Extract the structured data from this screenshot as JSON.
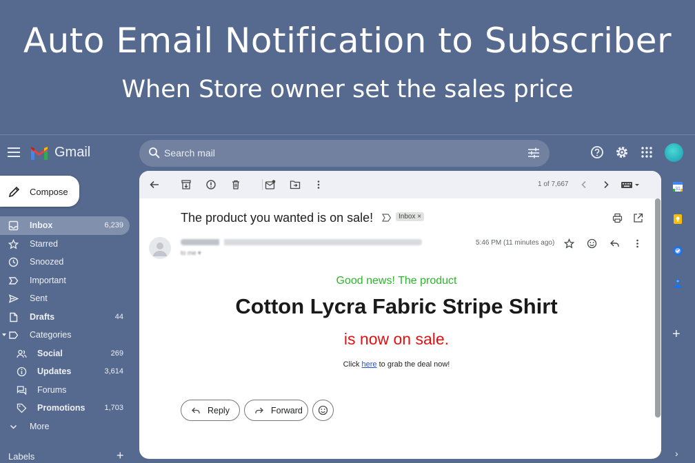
{
  "banner": {
    "title": "Auto Email Notification to Subscriber",
    "subtitle": "When Store owner set the sales price"
  },
  "app": {
    "name": "Gmail",
    "search_placeholder": "Search mail"
  },
  "compose_label": "Compose",
  "nav": {
    "inbox": {
      "label": "Inbox",
      "count": "6,239"
    },
    "starred": {
      "label": "Starred"
    },
    "snoozed": {
      "label": "Snoozed"
    },
    "important": {
      "label": "Important"
    },
    "sent": {
      "label": "Sent"
    },
    "drafts": {
      "label": "Drafts",
      "count": "44"
    },
    "categories": {
      "label": "Categories"
    },
    "social": {
      "label": "Social",
      "count": "269"
    },
    "updates": {
      "label": "Updates",
      "count": "3,614"
    },
    "forums": {
      "label": "Forums"
    },
    "promotions": {
      "label": "Promotions",
      "count": "1,703"
    },
    "more": {
      "label": "More"
    },
    "labels": {
      "label": "Labels"
    }
  },
  "toolbar": {
    "pagination": "1 of 7,667"
  },
  "email": {
    "subject": "The product you wanted is on sale!",
    "label_chip": "Inbox ×",
    "time": "5:46 PM (11 minutes ago)",
    "body": {
      "good_news": "Good news! The product",
      "product": "Cotton Lycra Fabric Stripe Shirt",
      "on_sale": "is now on sale.",
      "click_prefix": "Click ",
      "link_text": "here",
      "click_suffix": " to grab the deal now!"
    },
    "reply_label": "Reply",
    "forward_label": "Forward"
  },
  "colors": {
    "background": "#56698e",
    "green_text": "#2bb52b",
    "red_text": "#e21010",
    "link": "#1a4fd8"
  },
  "icons": [
    "menu-icon",
    "gmail-logo-icon",
    "search-icon",
    "search-options-icon",
    "help-icon",
    "settings-icon",
    "apps-icon",
    "pencil-icon",
    "inbox-icon",
    "star-icon",
    "clock-icon",
    "important-icon",
    "send-icon",
    "draft-icon",
    "label-icon",
    "people-icon",
    "info-icon",
    "forum-icon",
    "tag-icon",
    "chevron-down-icon",
    "back-icon",
    "archive-icon",
    "report-spam-icon",
    "delete-icon",
    "mark-unread-icon",
    "move-to-icon",
    "more-vert-icon",
    "chevron-left-icon",
    "chevron-right-icon",
    "keyboard-icon",
    "print-icon",
    "open-new-window-icon",
    "smiley-icon",
    "reply-icon",
    "forward-icon",
    "calendar-icon",
    "keep-icon",
    "tasks-icon",
    "contacts-icon",
    "plus-icon"
  ]
}
